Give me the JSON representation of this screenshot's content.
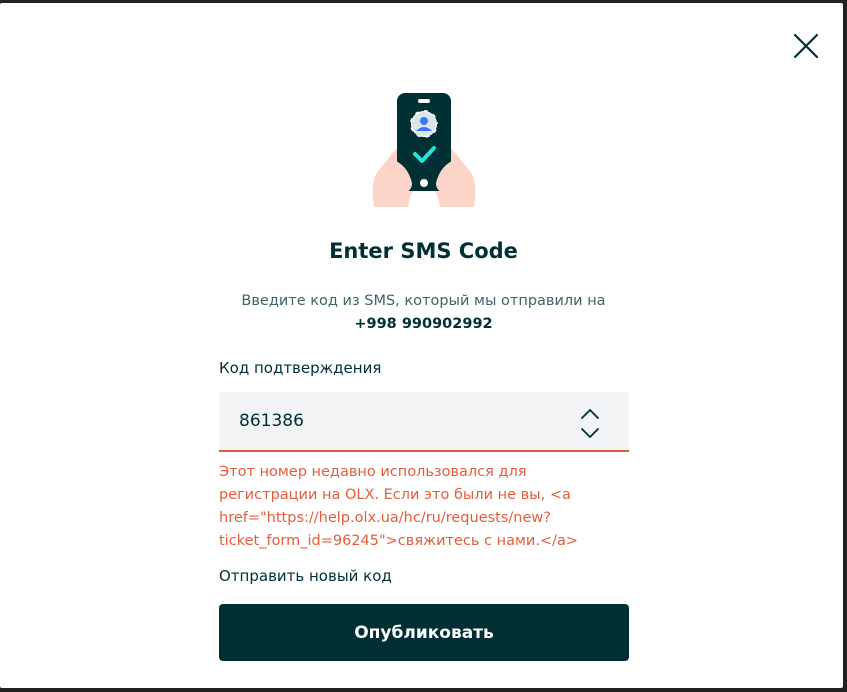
{
  "modal": {
    "title": "Enter SMS Code",
    "subtitle": "Введите код из SMS, который мы отправили на",
    "phone": "+998 990902992"
  },
  "form": {
    "label": "Код подтверждения",
    "value": "861386",
    "error": "Этот номер недавно использовался для регистрации на OLX. Если это были не вы, <a href=\"https://help.olx.ua/hc/ru/requests/new?ticket_form_id=96245\">свяжитесь с нами.</a>",
    "resend_label": "Отправить новый код",
    "submit_label": "Опубликовать"
  },
  "icons": {
    "close": "close-icon",
    "illustration": "phone-verification-illustration",
    "stepper_up": "chevron-up-icon",
    "stepper_down": "chevron-down-icon"
  },
  "colors": {
    "primary": "#002f34",
    "error": "#e65c3a",
    "input_bg": "#f2f4f5",
    "accent": "#23e5db"
  }
}
